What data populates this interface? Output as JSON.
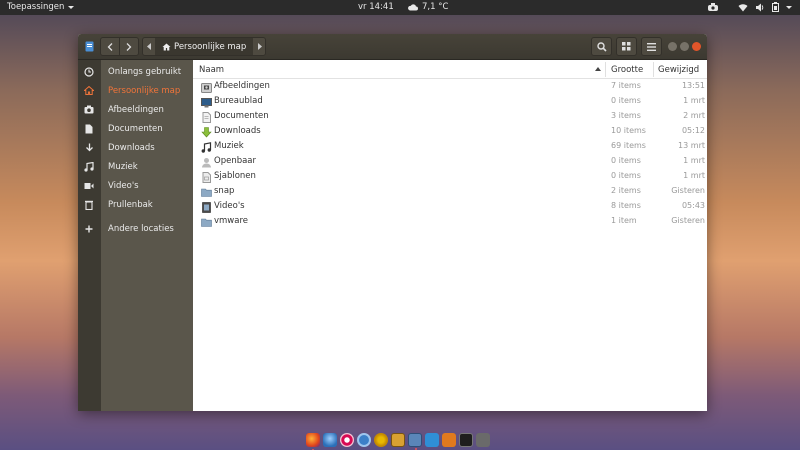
{
  "topbar": {
    "apps_label": "Toepassingen",
    "clock": "vr 14:41",
    "weather": "7,1 °C"
  },
  "window": {
    "path_current": "Persoonlijke map"
  },
  "sidebar": {
    "items": [
      {
        "label": "Onlangs gebruikt",
        "icon": "clock-icon"
      },
      {
        "label": "Persoonlijke map",
        "icon": "home-icon",
        "active": true
      },
      {
        "label": "Afbeeldingen",
        "icon": "camera-icon"
      },
      {
        "label": "Documenten",
        "icon": "document-icon"
      },
      {
        "label": "Downloads",
        "icon": "download-icon"
      },
      {
        "label": "Muziek",
        "icon": "music-icon"
      },
      {
        "label": "Video's",
        "icon": "video-icon"
      },
      {
        "label": "Prullenbak",
        "icon": "trash-icon"
      },
      {
        "label": "Andere locaties",
        "icon": "plus-icon"
      }
    ]
  },
  "list": {
    "columns": {
      "name": "Naam",
      "size": "Grootte",
      "modified": "Gewijzigd"
    },
    "rows": [
      {
        "name": "Afbeeldingen",
        "size": "7 items",
        "modified": "13:51",
        "icon": "pictures-folder-icon"
      },
      {
        "name": "Bureaublad",
        "size": "0 items",
        "modified": "1 mrt",
        "icon": "desktop-folder-icon"
      },
      {
        "name": "Documenten",
        "size": "3 items",
        "modified": "2 mrt",
        "icon": "documents-folder-icon"
      },
      {
        "name": "Downloads",
        "size": "10 items",
        "modified": "05:12",
        "icon": "downloads-folder-icon"
      },
      {
        "name": "Muziek",
        "size": "69 items",
        "modified": "13 mrt",
        "icon": "music-folder-icon"
      },
      {
        "name": "Openbaar",
        "size": "0 items",
        "modified": "1 mrt",
        "icon": "public-folder-icon"
      },
      {
        "name": "Sjablonen",
        "size": "0 items",
        "modified": "1 mrt",
        "icon": "templates-folder-icon"
      },
      {
        "name": "snap",
        "size": "2 items",
        "modified": "Gisteren",
        "icon": "folder-icon"
      },
      {
        "name": "Video's",
        "size": "8 items",
        "modified": "05:43",
        "icon": "videos-folder-icon"
      },
      {
        "name": "vmware",
        "size": "1 item",
        "modified": "Gisteren",
        "icon": "folder-icon"
      }
    ]
  },
  "colors": {
    "accent": "#f0743a",
    "headerbar": "#474339",
    "sidebar": "#5a564b"
  },
  "dock": {
    "apps": [
      "firefox-icon",
      "thunderbird-icon",
      "debian-icon",
      "qbittorrent-icon",
      "media-icon",
      "puzzle-icon",
      "files-icon",
      "software-install-icon",
      "package-icon",
      "terminal-icon",
      "network-icon"
    ]
  }
}
